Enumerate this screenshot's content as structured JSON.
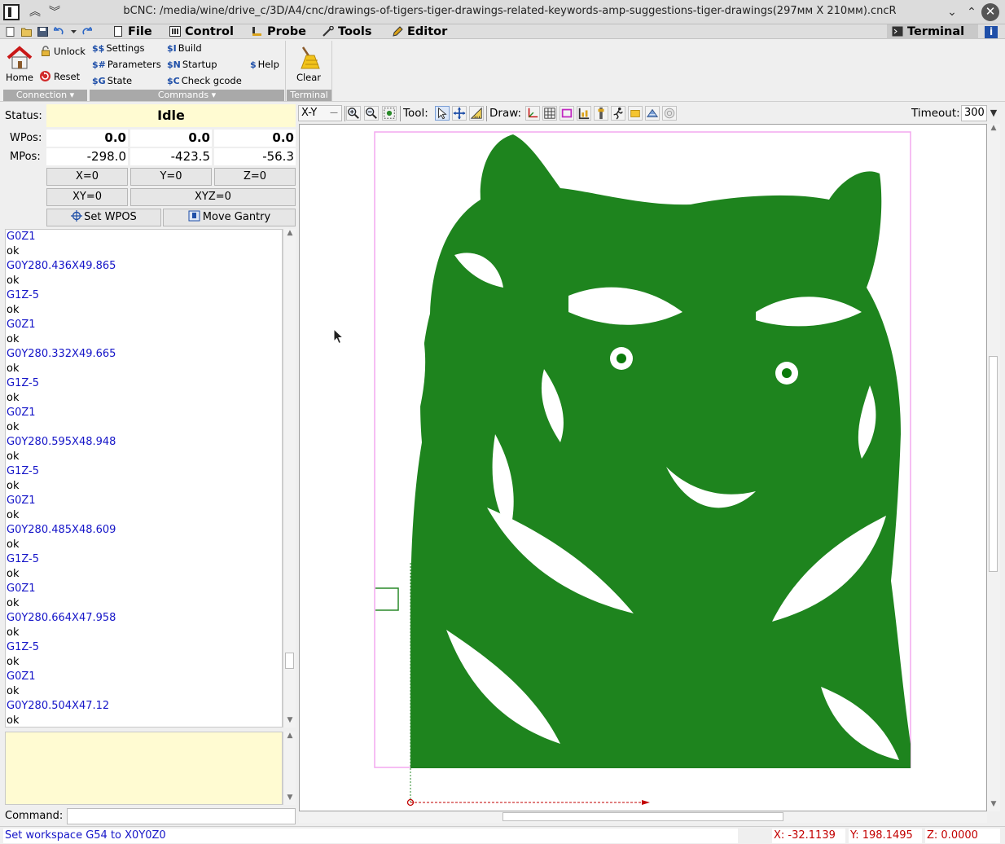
{
  "window": {
    "title": "bCNC: /media/wine/drive_c/3D/A4/cnc/drawings-of-tigers-tiger-drawings-related-keywords-amp-suggestions-tiger-drawings(297мм X 210мм).cncR",
    "icons": [
      "app-icon",
      "keep-above-icon",
      "minimize-to-tray-icon",
      "minimize-icon",
      "maximize-icon",
      "close-icon"
    ],
    "close_glyph": "✕"
  },
  "menu": {
    "file": "File",
    "control": "Control",
    "probe": "Probe",
    "tools": "Tools",
    "editor": "Editor",
    "terminal": "Terminal",
    "info": "i"
  },
  "ribbon": {
    "connection": {
      "home": "Home",
      "unlock": "Unlock",
      "reset": "Reset",
      "label": "Connection ▾"
    },
    "commands": {
      "settings_sym": "$$",
      "settings": "Settings",
      "parameters_sym": "$#",
      "parameters": "Parameters",
      "state_sym": "$G",
      "state": "State",
      "build_sym": "$I",
      "build": "Build",
      "startup_sym": "$N",
      "startup": "Startup",
      "check_sym": "$C",
      "check": "Check gcode",
      "help_sym": "$",
      "help": "Help",
      "label": "Commands ▾"
    },
    "terminal": {
      "clear": "Clear",
      "label": "Terminal"
    }
  },
  "state": {
    "status_label": "Status:",
    "status_value": "Idle",
    "wpos_label": "WPos:",
    "mpos_label": "MPos:",
    "wpos": [
      "0.0",
      "0.0",
      "0.0"
    ],
    "mpos": [
      "-298.0",
      "-423.5",
      "-56.3"
    ],
    "buttons": {
      "x0": "X=0",
      "y0": "Y=0",
      "z0": "Z=0",
      "xy0": "XY=0",
      "xyz0": "XYZ=0",
      "set_wpos": "Set WPOS",
      "move_gantry": "Move Gantry"
    }
  },
  "terminal_lines": [
    {
      "text": "G0Z1",
      "kind": "cmd"
    },
    {
      "text": "ok",
      "kind": "resp"
    },
    {
      "text": "G0Y280.436X49.865",
      "kind": "cmd"
    },
    {
      "text": "ok",
      "kind": "resp"
    },
    {
      "text": "G1Z-5",
      "kind": "cmd"
    },
    {
      "text": "ok",
      "kind": "resp"
    },
    {
      "text": "G0Z1",
      "kind": "cmd"
    },
    {
      "text": "ok",
      "kind": "resp"
    },
    {
      "text": "G0Y280.332X49.665",
      "kind": "cmd"
    },
    {
      "text": "ok",
      "kind": "resp"
    },
    {
      "text": "G1Z-5",
      "kind": "cmd"
    },
    {
      "text": "ok",
      "kind": "resp"
    },
    {
      "text": "G0Z1",
      "kind": "cmd"
    },
    {
      "text": "ok",
      "kind": "resp"
    },
    {
      "text": "G0Y280.595X48.948",
      "kind": "cmd"
    },
    {
      "text": "ok",
      "kind": "resp"
    },
    {
      "text": "G1Z-5",
      "kind": "cmd"
    },
    {
      "text": "ok",
      "kind": "resp"
    },
    {
      "text": "G0Z1",
      "kind": "cmd"
    },
    {
      "text": "ok",
      "kind": "resp"
    },
    {
      "text": "G0Y280.485X48.609",
      "kind": "cmd"
    },
    {
      "text": "ok",
      "kind": "resp"
    },
    {
      "text": "G1Z-5",
      "kind": "cmd"
    },
    {
      "text": "ok",
      "kind": "resp"
    },
    {
      "text": "G0Z1",
      "kind": "cmd"
    },
    {
      "text": "ok",
      "kind": "resp"
    },
    {
      "text": "G0Y280.664X47.958",
      "kind": "cmd"
    },
    {
      "text": "ok",
      "kind": "resp"
    },
    {
      "text": "G1Z-5",
      "kind": "cmd"
    },
    {
      "text": "ok",
      "kind": "resp"
    },
    {
      "text": "G0Z1",
      "kind": "cmd"
    },
    {
      "text": "ok",
      "kind": "resp"
    },
    {
      "text": "G0Y280.504X47.12",
      "kind": "cmd"
    },
    {
      "text": "ok",
      "kind": "resp"
    }
  ],
  "command": {
    "label": "Command:",
    "value": ""
  },
  "canvas_toolbar": {
    "view": "X-Y",
    "tool_label": "Tool:",
    "draw_label": "Draw:",
    "timeout_label": "Timeout:",
    "timeout_value": "300",
    "view_icons": [
      "zoom-in-icon",
      "zoom-out-icon",
      "zoom-fit-icon"
    ],
    "tool_icons": [
      "select-tool-icon",
      "pan-tool-icon",
      "ruler-tool-icon"
    ],
    "draw_icons": [
      "axes-icon",
      "grid-icon",
      "margins-icon",
      "probe-icon",
      "workarea-icon",
      "rapid-icon",
      "paths-icon",
      "render-icon",
      "camera-icon"
    ]
  },
  "canvas": {
    "drawing_color": "#0b7a0b",
    "margin_color": "#f3a8ef",
    "axis_color": "#c30000"
  },
  "statusbar": {
    "message": "Set workspace G54 to X0Y0Z0",
    "x": "X: -32.1139",
    "y": "Y: 198.1495",
    "z": "Z: 0.0000"
  }
}
